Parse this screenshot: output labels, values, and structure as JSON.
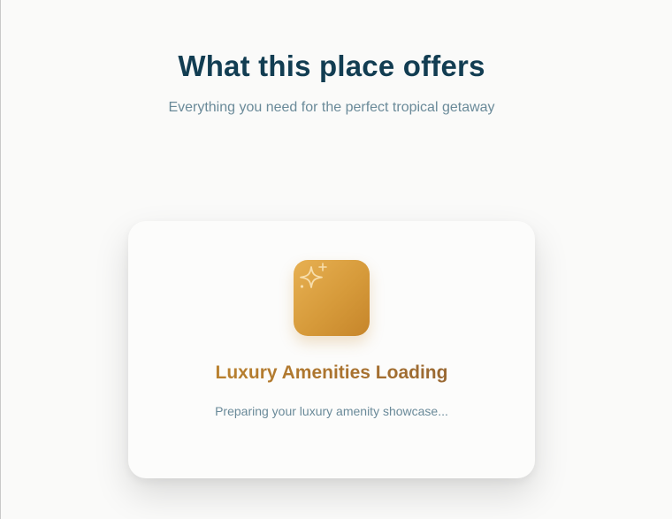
{
  "header": {
    "title": "What this place offers",
    "subtitle": "Everything you need for the perfect tropical getaway"
  },
  "loading_card": {
    "icon": "sparkles-icon",
    "title": "Luxury Amenities Loading",
    "message": "Preparing your luxury amenity showcase..."
  },
  "colors": {
    "title": "#123d52",
    "muted_text": "#6a8a99",
    "gold_start": "#e7b052",
    "gold_end": "#c6852a",
    "background": "#fafaf9"
  }
}
